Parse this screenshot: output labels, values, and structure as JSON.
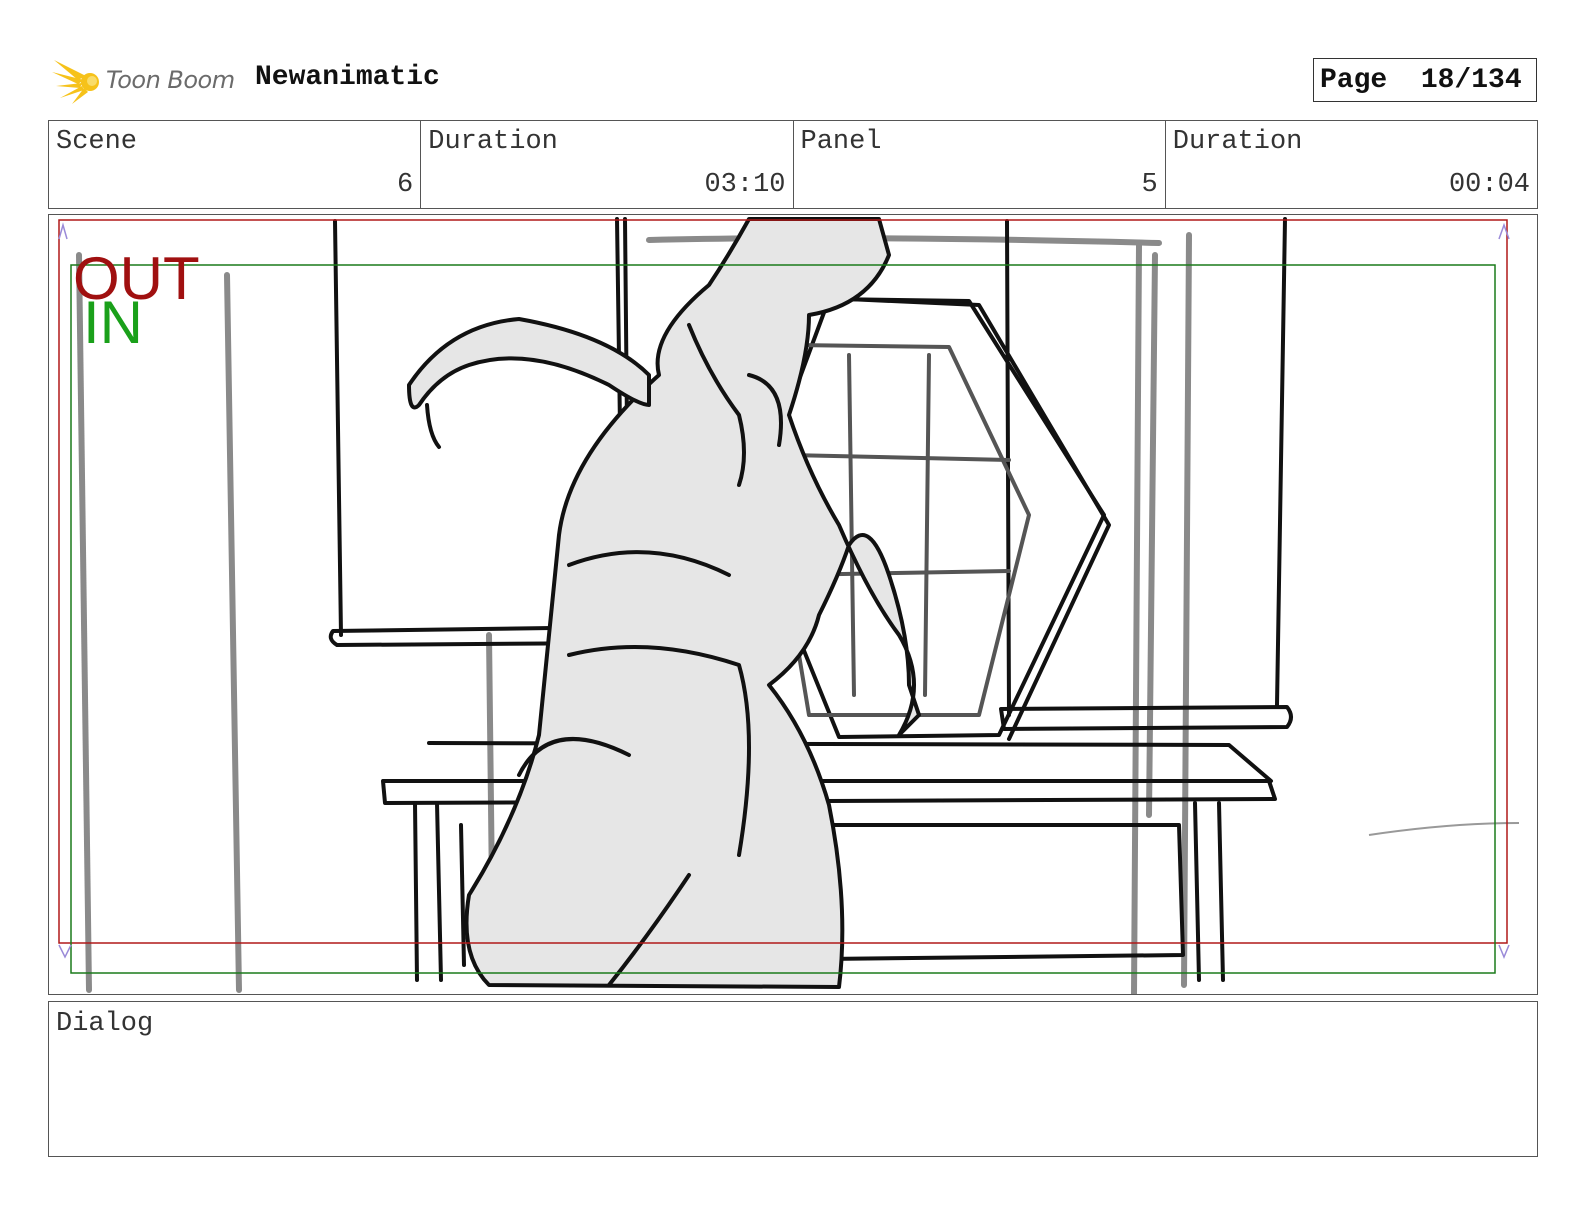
{
  "header": {
    "brand": "Toon Boom",
    "project_title": "Newanimatic",
    "page_label": "Page",
    "page_value": "18/134"
  },
  "info": {
    "scene_label": "Scene",
    "scene_value": "6",
    "scene_duration_label": "Duration",
    "scene_duration_value": "03:10",
    "panel_label": "Panel",
    "panel_value": "5",
    "panel_duration_label": "Duration",
    "panel_duration_value": "00:04"
  },
  "frame": {
    "out_label": "OUT",
    "in_label": "IN",
    "out_color": "#a01010",
    "in_color": "#1aa01a"
  },
  "dialog": {
    "label": "Dialog",
    "text": ""
  },
  "icons": {
    "logo": "toon-boom-star-icon"
  }
}
